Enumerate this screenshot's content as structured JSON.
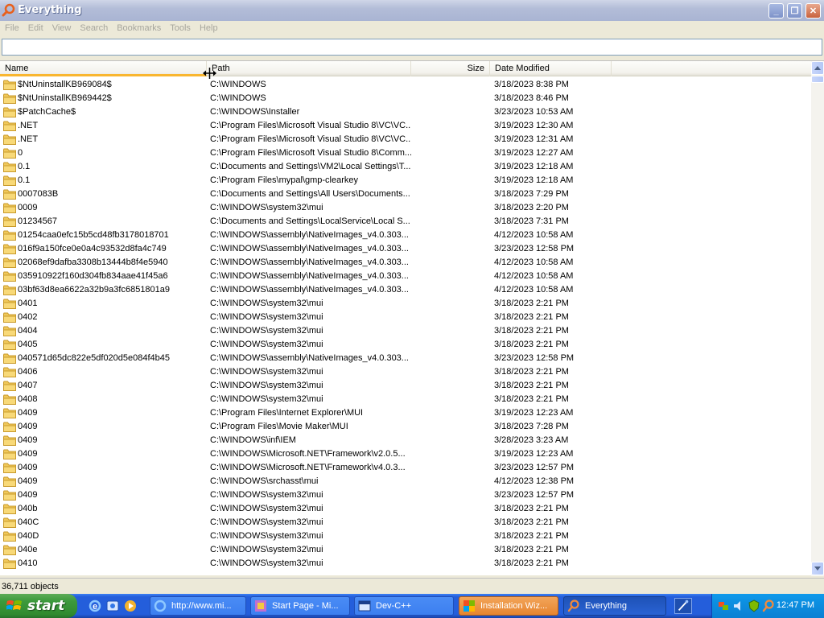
{
  "window": {
    "title": "Everything",
    "minimize": "_",
    "maximize": "❐",
    "close": "✕"
  },
  "menu": [
    "File",
    "Edit",
    "View",
    "Search",
    "Bookmarks",
    "Tools",
    "Help"
  ],
  "search": {
    "value": "",
    "placeholder": ""
  },
  "columns": {
    "name": "Name",
    "path": "Path",
    "size": "Size",
    "date": "Date Modified"
  },
  "rows": [
    {
      "name": "$NtUninstallKB969084$",
      "path": "C:\\WINDOWS",
      "date": "3/18/2023 8:38 PM"
    },
    {
      "name": "$NtUninstallKB969442$",
      "path": "C:\\WINDOWS",
      "date": "3/18/2023 8:46 PM"
    },
    {
      "name": "$PatchCache$",
      "path": "C:\\WINDOWS\\Installer",
      "date": "3/23/2023 10:53 AM"
    },
    {
      "name": ".NET",
      "path": "C:\\Program Files\\Microsoft Visual Studio 8\\VC\\VC...",
      "date": "3/19/2023 12:30 AM"
    },
    {
      "name": ".NET",
      "path": "C:\\Program Files\\Microsoft Visual Studio 8\\VC\\VC...",
      "date": "3/19/2023 12:31 AM"
    },
    {
      "name": "0",
      "path": "C:\\Program Files\\Microsoft Visual Studio 8\\Comm...",
      "date": "3/19/2023 12:27 AM"
    },
    {
      "name": "0.1",
      "path": "C:\\Documents and Settings\\VM2\\Local Settings\\T...",
      "date": "3/19/2023 12:18 AM"
    },
    {
      "name": "0.1",
      "path": "C:\\Program Files\\mypal\\gmp-clearkey",
      "date": "3/19/2023 12:18 AM"
    },
    {
      "name": "0007083B",
      "path": "C:\\Documents and Settings\\All Users\\Documents...",
      "date": "3/18/2023 7:29 PM"
    },
    {
      "name": "0009",
      "path": "C:\\WINDOWS\\system32\\mui",
      "date": "3/18/2023 2:20 PM"
    },
    {
      "name": "01234567",
      "path": "C:\\Documents and Settings\\LocalService\\Local S...",
      "date": "3/18/2023 7:31 PM"
    },
    {
      "name": "01254caa0efc15b5cd48fb3178018701",
      "path": "C:\\WINDOWS\\assembly\\NativeImages_v4.0.303...",
      "date": "4/12/2023 10:58 AM"
    },
    {
      "name": "016f9a150fce0e0a4c93532d8fa4c749",
      "path": "C:\\WINDOWS\\assembly\\NativeImages_v4.0.303...",
      "date": "3/23/2023 12:58 PM"
    },
    {
      "name": "02068ef9dafba3308b13444b8f4e5940",
      "path": "C:\\WINDOWS\\assembly\\NativeImages_v4.0.303...",
      "date": "4/12/2023 10:58 AM"
    },
    {
      "name": "035910922f160d304fb834aae41f45a6",
      "path": "C:\\WINDOWS\\assembly\\NativeImages_v4.0.303...",
      "date": "4/12/2023 10:58 AM"
    },
    {
      "name": "03bf63d8ea6622a32b9a3fc6851801a9",
      "path": "C:\\WINDOWS\\assembly\\NativeImages_v4.0.303...",
      "date": "4/12/2023 10:58 AM"
    },
    {
      "name": "0401",
      "path": "C:\\WINDOWS\\system32\\mui",
      "date": "3/18/2023 2:21 PM"
    },
    {
      "name": "0402",
      "path": "C:\\WINDOWS\\system32\\mui",
      "date": "3/18/2023 2:21 PM"
    },
    {
      "name": "0404",
      "path": "C:\\WINDOWS\\system32\\mui",
      "date": "3/18/2023 2:21 PM"
    },
    {
      "name": "0405",
      "path": "C:\\WINDOWS\\system32\\mui",
      "date": "3/18/2023 2:21 PM"
    },
    {
      "name": "040571d65dc822e5df020d5e084f4b45",
      "path": "C:\\WINDOWS\\assembly\\NativeImages_v4.0.303...",
      "date": "3/23/2023 12:58 PM"
    },
    {
      "name": "0406",
      "path": "C:\\WINDOWS\\system32\\mui",
      "date": "3/18/2023 2:21 PM"
    },
    {
      "name": "0407",
      "path": "C:\\WINDOWS\\system32\\mui",
      "date": "3/18/2023 2:21 PM"
    },
    {
      "name": "0408",
      "path": "C:\\WINDOWS\\system32\\mui",
      "date": "3/18/2023 2:21 PM"
    },
    {
      "name": "0409",
      "path": "C:\\Program Files\\Internet Explorer\\MUI",
      "date": "3/19/2023 12:23 AM"
    },
    {
      "name": "0409",
      "path": "C:\\Program Files\\Movie Maker\\MUI",
      "date": "3/18/2023 7:28 PM"
    },
    {
      "name": "0409",
      "path": "C:\\WINDOWS\\inf\\IEM",
      "date": "3/28/2023 3:23 AM"
    },
    {
      "name": "0409",
      "path": "C:\\WINDOWS\\Microsoft.NET\\Framework\\v2.0.5...",
      "date": "3/19/2023 12:23 AM"
    },
    {
      "name": "0409",
      "path": "C:\\WINDOWS\\Microsoft.NET\\Framework\\v4.0.3...",
      "date": "3/23/2023 12:57 PM"
    },
    {
      "name": "0409",
      "path": "C:\\WINDOWS\\srchasst\\mui",
      "date": "4/12/2023 12:38 PM"
    },
    {
      "name": "0409",
      "path": "C:\\WINDOWS\\system32\\mui",
      "date": "3/23/2023 12:57 PM"
    },
    {
      "name": "040b",
      "path": "C:\\WINDOWS\\system32\\mui",
      "date": "3/18/2023 2:21 PM"
    },
    {
      "name": "040C",
      "path": "C:\\WINDOWS\\system32\\mui",
      "date": "3/18/2023 2:21 PM"
    },
    {
      "name": "040D",
      "path": "C:\\WINDOWS\\system32\\mui",
      "date": "3/18/2023 2:21 PM"
    },
    {
      "name": "040e",
      "path": "C:\\WINDOWS\\system32\\mui",
      "date": "3/18/2023 2:21 PM"
    },
    {
      "name": "0410",
      "path": "C:\\WINDOWS\\system32\\mui",
      "date": "3/18/2023 2:21 PM"
    }
  ],
  "status": {
    "count": "36,711 objects"
  },
  "taskbar": {
    "start": "start",
    "buttons": [
      {
        "label": "http://www.mi...",
        "icon": "ie-icon",
        "style": "normal"
      },
      {
        "label": "Start Page - Mi...",
        "icon": "visual-studio-icon",
        "style": "normal"
      },
      {
        "label": "Dev-C++",
        "icon": "devcpp-icon",
        "style": "normal"
      },
      {
        "label": "Installation Wiz...",
        "icon": "installer-icon",
        "style": "orange"
      },
      {
        "label": "Everything",
        "icon": "everything-icon",
        "style": "active"
      }
    ],
    "clock": "12:47 PM"
  },
  "colors": {
    "folder": "#f0c85a",
    "folderDark": "#c99a2a",
    "activeColumn": "#f9b62f",
    "taskbar": "#245edb",
    "start": "#3c9a3c"
  }
}
